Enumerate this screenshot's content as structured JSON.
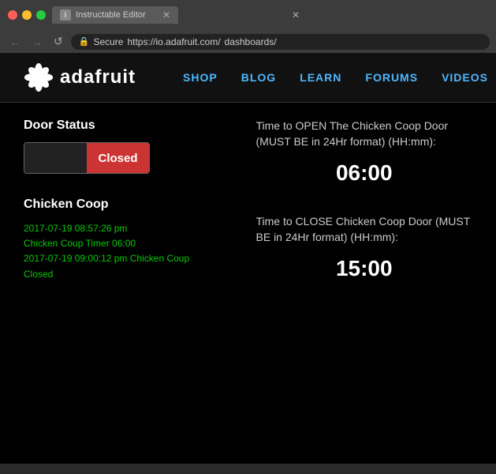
{
  "browser": {
    "tab_active": "Instructable Editor",
    "tab_favicon": "I",
    "tab_inactive": "",
    "url_secure": "Secure",
    "url": "https://io.adafruit.com/",
    "url_suffix": "dashboards/",
    "nav_back": "←",
    "nav_forward": "→",
    "nav_refresh": "↺"
  },
  "site": {
    "logo_text": "adafruit",
    "nav": [
      {
        "label": "SHOP"
      },
      {
        "label": "BLOG"
      },
      {
        "label": "LEARN"
      },
      {
        "label": "FORUMS"
      },
      {
        "label": "VIDEOS"
      }
    ]
  },
  "door_status": {
    "title": "Door Status",
    "state": "Closed"
  },
  "chicken_coop": {
    "title": "Chicken Coop",
    "logs": [
      "2017-07-19 08:57:26 pm",
      "Chicken Coup Timer 06:00",
      "2017-07-19 09:00:12 pm Chicken Coup",
      "Closed"
    ]
  },
  "open_time": {
    "label": "Time to OPEN The Chicken Coop Door (MUST BE in 24Hr format) (HH:mm):",
    "value": "06:00"
  },
  "close_time": {
    "label": "Time to CLOSE Chicken Coop Door (MUST BE in 24Hr format) (HH:mm):",
    "value": "15:00"
  }
}
